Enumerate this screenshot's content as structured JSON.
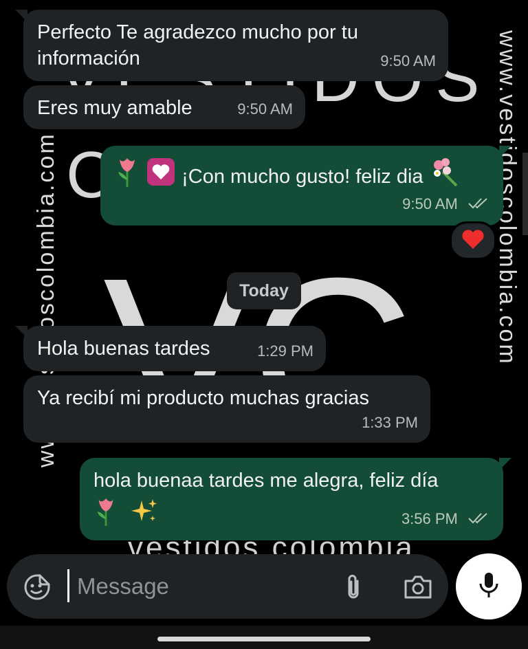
{
  "wallpaper": {
    "big_text": "VC",
    "mid_top": "VESTIDOS",
    "mid_left": "C",
    "vert_right": "www.vestidoscolombia.com",
    "vert_left": "www.vestidoscolombia.com",
    "bottom": "vestidos colombia"
  },
  "messages": [
    {
      "text_line1": "Perfecto Te agradezco mucho por tu",
      "text_line2": "información",
      "time": "9:50 AM"
    },
    {
      "text": "Eres muy amable",
      "time": "9:50 AM"
    },
    {
      "text": "¡Con mucho gusto! feliz dia",
      "time": "9:50 AM",
      "status": "read"
    },
    {
      "text": "Hola buenas tardes",
      "time": "1:29 PM"
    },
    {
      "text": "Ya recibí mi producto muchas gracias",
      "time": "1:33 PM"
    },
    {
      "text": "hola buenaa tardes me alegra, feliz día",
      "time": "3:56 PM",
      "status": "read"
    }
  ],
  "reaction": "heart",
  "date_separator": "Today",
  "composer": {
    "placeholder": "Message",
    "icons": [
      "sticker-icon",
      "attach-icon",
      "camera-icon",
      "mic-icon"
    ]
  },
  "colors": {
    "incoming": "#1f2326",
    "outgoing": "#144d37",
    "background": "#000000"
  }
}
